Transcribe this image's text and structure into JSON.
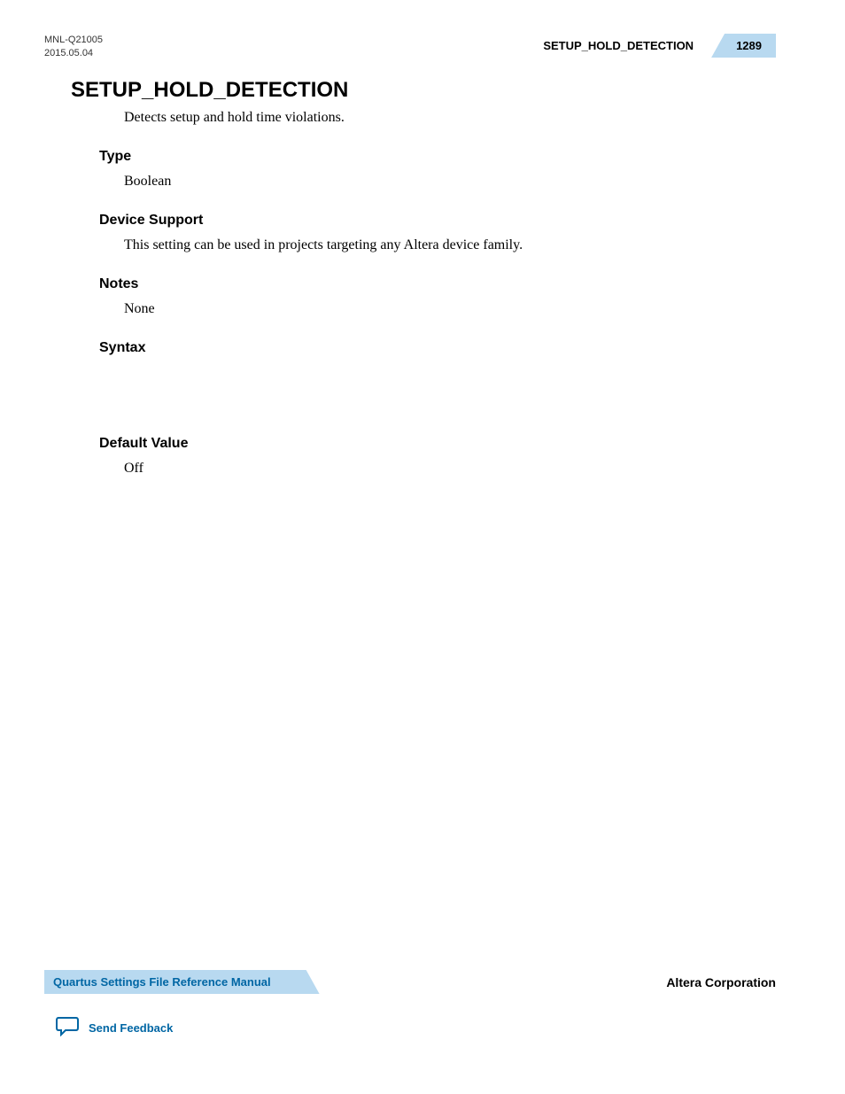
{
  "header": {
    "doc_id": "MNL-Q21005",
    "date": "2015.05.04",
    "section_title": "SETUP_HOLD_DETECTION",
    "page_number": "1289"
  },
  "main": {
    "heading": "SETUP_HOLD_DETECTION",
    "description": "Detects setup and hold time violations.",
    "sections": {
      "type": {
        "heading": "Type",
        "text": "Boolean"
      },
      "device_support": {
        "heading": "Device Support",
        "text": "This setting can be used in projects targeting any Altera device family."
      },
      "notes": {
        "heading": "Notes",
        "text": "None"
      },
      "syntax": {
        "heading": "Syntax",
        "text": ""
      },
      "default_value": {
        "heading": "Default Value",
        "text": "Off"
      }
    }
  },
  "footer": {
    "manual_title": "Quartus Settings File Reference Manual",
    "company": "Altera Corporation",
    "feedback_label": "Send Feedback"
  }
}
